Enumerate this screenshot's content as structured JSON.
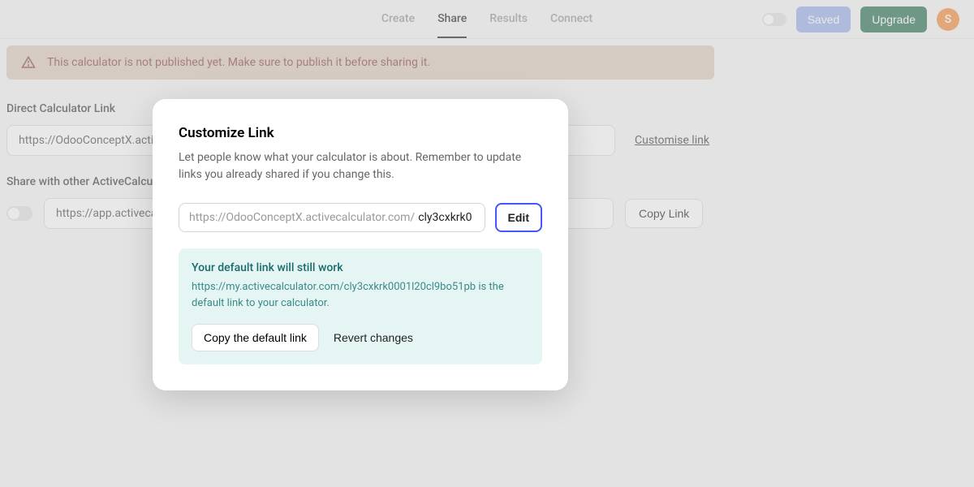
{
  "header": {
    "tabs": [
      "Create",
      "Share",
      "Results",
      "Connect"
    ],
    "active_tab": "Share",
    "saved_label": "Saved",
    "upgrade_label": "Upgrade",
    "avatar_initial": "S"
  },
  "alert": {
    "text": "This calculator is not published yet. Make sure to publish it before sharing it."
  },
  "direct_link": {
    "label": "Direct Calculator Link",
    "value": "https://OdooConceptX.activecalculator.com/",
    "customise_label": "Customise link"
  },
  "share_other": {
    "label": "Share with other ActiveCalculator users",
    "value": "https://app.activecalculator.com/",
    "copy_label": "Copy Link"
  },
  "modal": {
    "title": "Customize Link",
    "description": "Let people know what your calculator is about. Remember to update links you already shared if you change this.",
    "prefix": "https://OdooConceptX.activecalculator.com/",
    "slug": "cly3cxkrk0",
    "edit_label": "Edit",
    "info_title": "Your default link will still work",
    "info_text": "https://my.activecalculator.com/cly3cxkrk0001l20cl9bo51pb is the default link to your calculator.",
    "copy_default_label": "Copy the default link",
    "revert_label": "Revert changes"
  }
}
